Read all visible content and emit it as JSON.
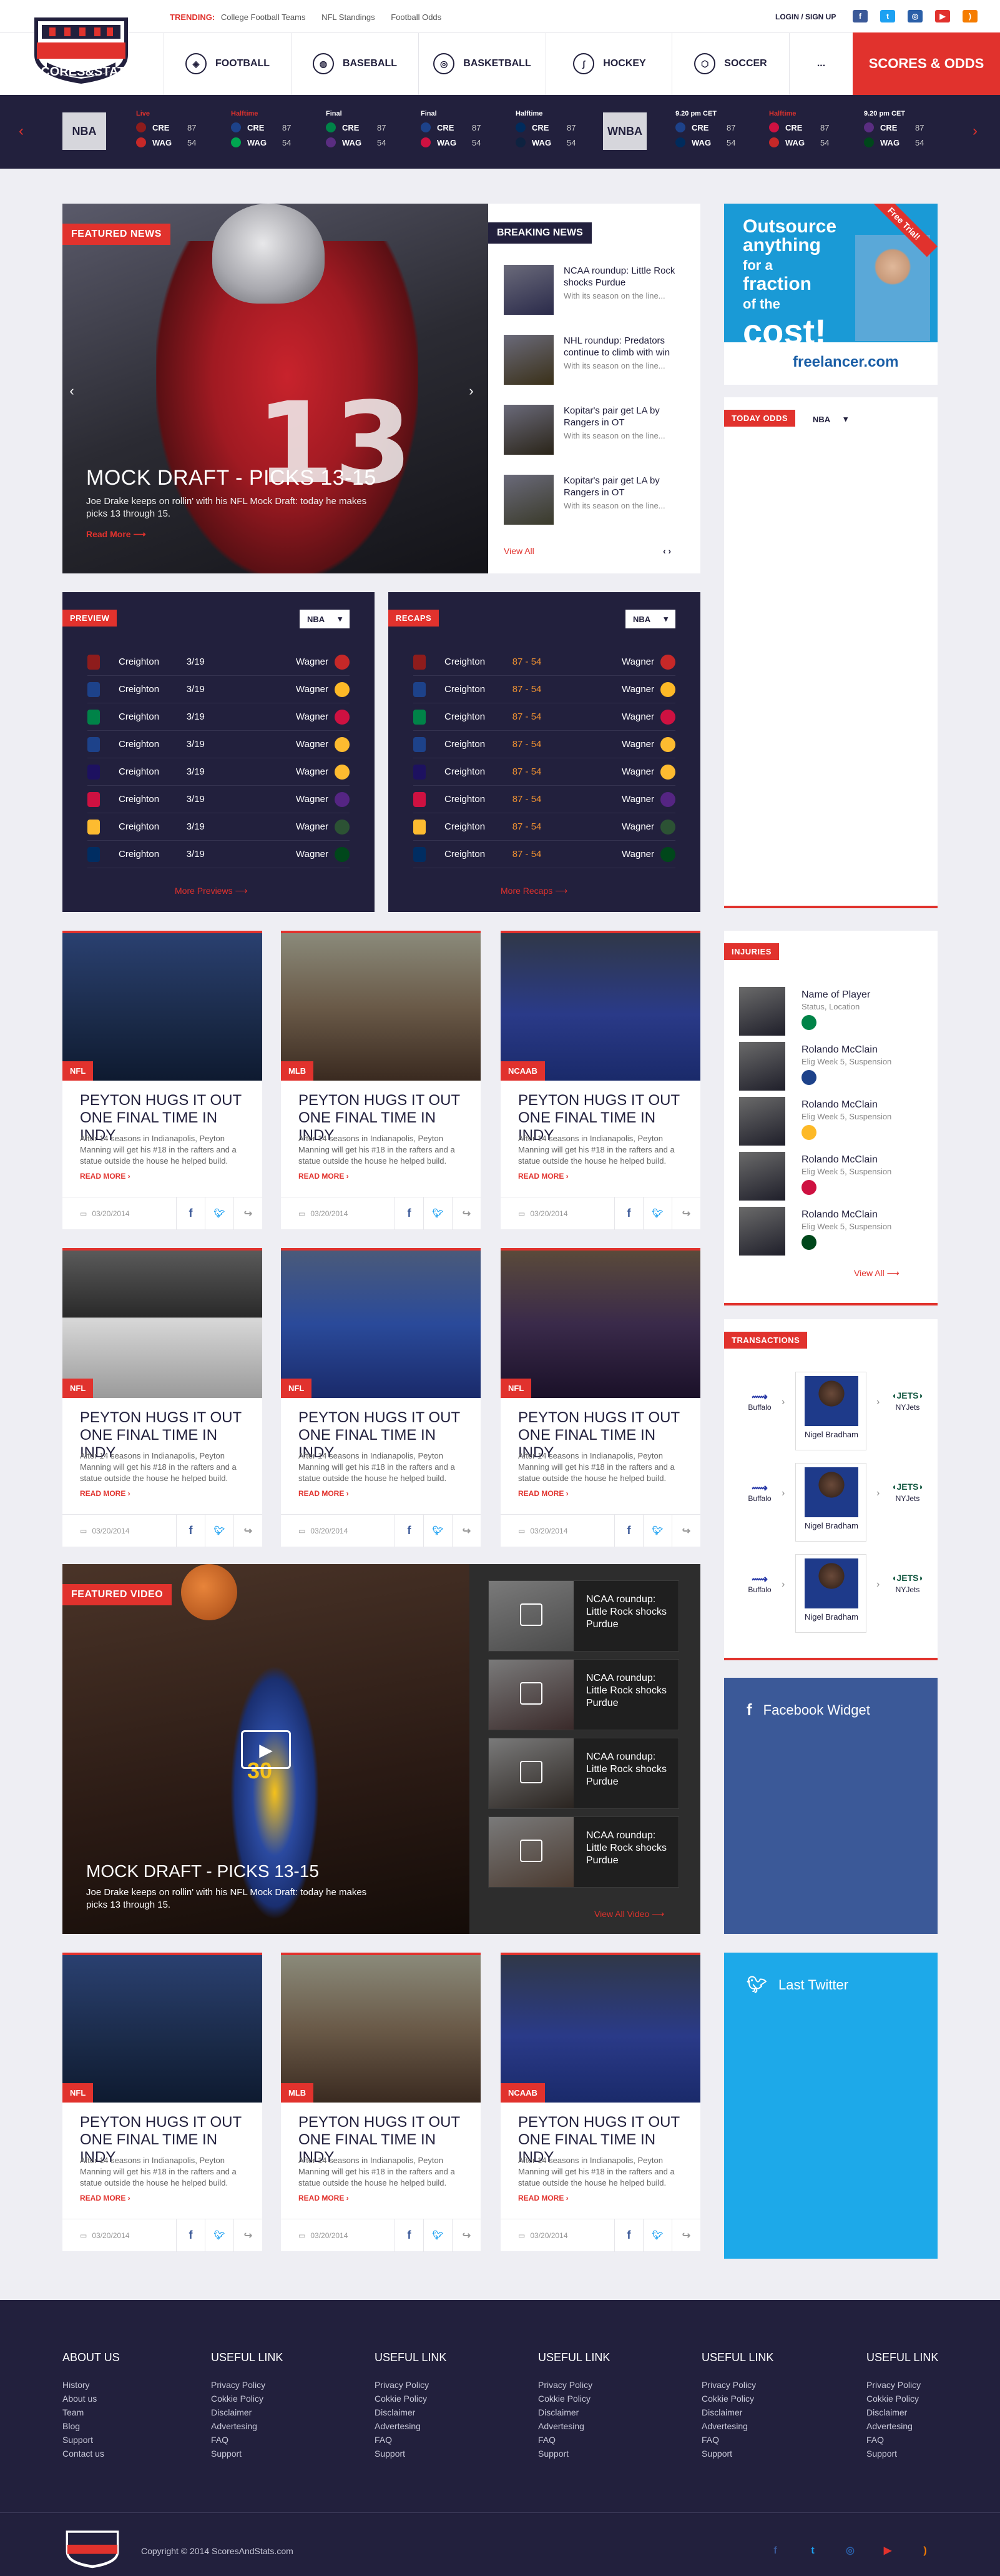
{
  "topbar": {
    "trending_label": "TRENDING:",
    "trending": [
      "College Football Teams",
      "NFL Standings",
      "Football Odds"
    ],
    "login": "LOGIN / SIGN UP",
    "social": [
      {
        "icon": "facebook-icon",
        "glyph": "f",
        "color": "#3b5998"
      },
      {
        "icon": "twitter-icon",
        "glyph": "t",
        "color": "#1da1f2"
      },
      {
        "icon": "instagram-icon",
        "glyph": "◎",
        "color": "#2a5fa8"
      },
      {
        "icon": "youtube-icon",
        "glyph": "▶",
        "color": "#e1322d"
      },
      {
        "icon": "rss-icon",
        "glyph": ")",
        "color": "#f57c00"
      }
    ]
  },
  "logo": {
    "text": "SCORES&STATS"
  },
  "nav": {
    "items": [
      {
        "label": "FOOTBALL",
        "icon": "football-icon",
        "glyph": "◈"
      },
      {
        "label": "BASEBALL",
        "icon": "baseball-icon",
        "glyph": "◍"
      },
      {
        "label": "BASKETBALL",
        "icon": "basketball-icon",
        "glyph": "◎"
      },
      {
        "label": "HOCKEY",
        "icon": "hockey-icon",
        "glyph": "∫"
      },
      {
        "label": "SOCCER",
        "icon": "soccer-icon",
        "glyph": "⬡"
      }
    ],
    "more": "...",
    "cta": "SCORES & ODDS"
  },
  "ticker": {
    "league1": "NBA",
    "league2": "WNBA",
    "games": [
      {
        "status": "Live",
        "red": true,
        "t1": "CRE",
        "s1": "87",
        "t2": "WAG",
        "s2": "54",
        "c1": "#8e1c1c",
        "c2": "#c62828"
      },
      {
        "status": "Halftime",
        "red": true,
        "t1": "CRE",
        "s1": "87",
        "t2": "WAG",
        "s2": "54",
        "c1": "#1d428a",
        "c2": "#00a650"
      },
      {
        "status": "Final",
        "red": false,
        "t1": "CRE",
        "s1": "87",
        "t2": "WAG",
        "s2": "54",
        "c1": "#008348",
        "c2": "#5a2d81"
      },
      {
        "status": "Final",
        "red": false,
        "t1": "CRE",
        "s1": "87",
        "t2": "WAG",
        "s2": "54",
        "c1": "#1d428a",
        "c2": "#ce1141"
      },
      {
        "status": "Halftime",
        "red": false,
        "t1": "CRE",
        "s1": "87",
        "t2": "WAG",
        "s2": "54",
        "c1": "#002b5c",
        "c2": "#0e2240"
      },
      {
        "status": "9.20 pm CET",
        "red": false,
        "t1": "CRE",
        "s1": "87",
        "t2": "WAG",
        "s2": "54",
        "c1": "#1d428a",
        "c2": "#002b5c"
      },
      {
        "status": "Halftime",
        "red": true,
        "t1": "CRE",
        "s1": "87",
        "t2": "WAG",
        "s2": "54",
        "c1": "#ce1141",
        "c2": "#c62828"
      },
      {
        "status": "9.20 pm CET",
        "red": false,
        "t1": "CRE",
        "s1": "87",
        "t2": "WAG",
        "s2": "54",
        "c1": "#5a2d81",
        "c2": "#00471b"
      }
    ]
  },
  "featured_news": {
    "tag": "FEATURED NEWS",
    "title": "MOCK DRAFT - PICKS 13-15",
    "text": "Joe Drake keeps on rollin' with his NFL Mock Draft: today he makes picks 13 through 15.",
    "read_more": "Read More",
    "jersey_number": "13"
  },
  "breaking": {
    "tag": "BREAKING NEWS",
    "items": [
      {
        "title": "NCAA roundup: Little Rock shocks Purdue",
        "sub": "With its season on the line..."
      },
      {
        "title": "NHL roundup: Predators continue to climb with win",
        "sub": "With its season on the line..."
      },
      {
        "title": "Kopitar's pair get LA by Rangers in OT",
        "sub": "With its season on the line..."
      },
      {
        "title": "Kopitar's pair get LA by Rangers in OT",
        "sub": "With its season on the line..."
      }
    ],
    "view_all": "View All"
  },
  "ad": {
    "line1": "Outsource",
    "line2": "anything",
    "line3": "for a",
    "line4": "fraction",
    "line5": "of the",
    "line6": "cost!",
    "ribbon": "Free Trial!",
    "brand": "freelancer.com"
  },
  "today_odds": {
    "tag": "TODAY ODDS",
    "select": "NBA"
  },
  "preview": {
    "tag": "PREVIEW",
    "select": "NBA",
    "rows": [
      {
        "t1": "Creighton",
        "mid": "3/19",
        "t2": "Wagner",
        "c1": "#8e1c1c",
        "c2": "#c62828"
      },
      {
        "t1": "Creighton",
        "mid": "3/19",
        "t2": "Wagner",
        "c1": "#1d428a",
        "c2": "#fdb927"
      },
      {
        "t1": "Creighton",
        "mid": "3/19",
        "t2": "Wagner",
        "c1": "#008348",
        "c2": "#ce1141"
      },
      {
        "t1": "Creighton",
        "mid": "3/19",
        "t2": "Wagner",
        "c1": "#1d428a",
        "c2": "#fdbb30"
      },
      {
        "t1": "Creighton",
        "mid": "3/19",
        "t2": "Wagner",
        "c1": "#1d1160",
        "c2": "#fdbb30"
      },
      {
        "t1": "Creighton",
        "mid": "3/19",
        "t2": "Wagner",
        "c1": "#ce1141",
        "c2": "#552583"
      },
      {
        "t1": "Creighton",
        "mid": "3/19",
        "t2": "Wagner",
        "c1": "#fdbb30",
        "c2": "#2c5234"
      },
      {
        "t1": "Creighton",
        "mid": "3/19",
        "t2": "Wagner",
        "c1": "#002d62",
        "c2": "#00471b"
      }
    ],
    "more": "More Previews"
  },
  "recaps": {
    "tag": "RECAPS",
    "select": "NBA",
    "rows": [
      {
        "t1": "Creighton",
        "mid": "87 - 54",
        "t2": "Wagner",
        "c1": "#8e1c1c",
        "c2": "#c62828"
      },
      {
        "t1": "Creighton",
        "mid": "87 - 54",
        "t2": "Wagner",
        "c1": "#1d428a",
        "c2": "#fdb927"
      },
      {
        "t1": "Creighton",
        "mid": "87 - 54",
        "t2": "Wagner",
        "c1": "#008348",
        "c2": "#ce1141"
      },
      {
        "t1": "Creighton",
        "mid": "87 - 54",
        "t2": "Wagner",
        "c1": "#1d428a",
        "c2": "#fdbb30"
      },
      {
        "t1": "Creighton",
        "mid": "87 - 54",
        "t2": "Wagner",
        "c1": "#1d1160",
        "c2": "#fdbb30"
      },
      {
        "t1": "Creighton",
        "mid": "87 - 54",
        "t2": "Wagner",
        "c1": "#ce1141",
        "c2": "#552583"
      },
      {
        "t1": "Creighton",
        "mid": "87 - 54",
        "t2": "Wagner",
        "c1": "#fdbb30",
        "c2": "#2c5234"
      },
      {
        "t1": "Creighton",
        "mid": "87 - 54",
        "t2": "Wagner",
        "c1": "#002d62",
        "c2": "#00471b"
      }
    ],
    "more": "More Recaps"
  },
  "cards": [
    {
      "label": "NFL",
      "title": "PEYTON HUGS IT OUT ONE FINAL TIME IN INDY",
      "text": "After 14 seasons in Indianapolis, Peyton Manning will get his #18 in the rafters and a statue outside the house he helped build.",
      "read_more": "READ MORE",
      "date": "03/20/2014",
      "bg": "linear-gradient(180deg,#2a4070 0%,#1a2a48 60%,#0e1a30 100%)"
    },
    {
      "label": "MLB",
      "title": "PEYTON HUGS IT OUT ONE FINAL TIME IN INDY",
      "text": "After 14 seasons in Indianapolis, Peyton Manning will get his #18 in the rafters and a statue outside the house he helped build.",
      "read_more": "READ MORE",
      "date": "03/20/2014",
      "bg": "linear-gradient(180deg,#8a8a7a 0%,#6a5a48 50%,#3a2a20 100%)"
    },
    {
      "label": "NCAAB",
      "title": "PEYTON HUGS IT OUT ONE FINAL TIME IN INDY",
      "text": "After 14 seasons in Indianapolis, Peyton Manning will get his #18 in the rafters and a statue outside the house he helped build.",
      "read_more": "READ MORE",
      "date": "03/20/2014",
      "bg": "linear-gradient(180deg,#303848 0%,#2a3a88 55%,#1a2a6a 100%)"
    },
    {
      "label": "NFL",
      "title": "PEYTON HUGS IT OUT ONE FINAL TIME IN INDY",
      "text": "After 14 seasons in Indianapolis, Peyton Manning will get his #18 in the rafters and a statue outside the house he helped build.",
      "read_more": "READ MORE",
      "date": "03/20/2014",
      "bg": "linear-gradient(180deg,#5a5a5a 0%,#2a2a2a 45%,#d8d8d8 46%,#9a9a9a 100%)"
    },
    {
      "label": "NFL",
      "title": "PEYTON HUGS IT OUT ONE FINAL TIME IN INDY",
      "text": "After 14 seasons in Indianapolis, Peyton Manning will get his #18 in the rafters and a statue outside the house he helped build.",
      "read_more": "READ MORE",
      "date": "03/20/2014",
      "bg": "linear-gradient(180deg,#4a5a7a 0%,#2a4a9a 50%,#1a2a6a 100%)"
    },
    {
      "label": "NFL",
      "title": "PEYTON HUGS IT OUT ONE FINAL TIME IN INDY",
      "text": "After 14 seasons in Indianapolis, Peyton Manning will get his #18 in the rafters and a statue outside the house he helped build.",
      "read_more": "READ MORE",
      "date": "03/20/2014",
      "bg": "linear-gradient(180deg,#5a4a3a 0%,#3a2a4a 50%,#1a1028 100%)"
    },
    {
      "label": "NFL",
      "title": "PEYTON HUGS IT OUT ONE FINAL TIME IN INDY",
      "text": "After 14 seasons in Indianapolis, Peyton Manning will get his #18 in the rafters and a statue outside the house he helped build.",
      "read_more": "READ MORE",
      "date": "03/20/2014",
      "bg": "linear-gradient(180deg,#2a4070 0%,#1a2a48 60%,#0e1a30 100%)"
    },
    {
      "label": "MLB",
      "title": "PEYTON HUGS IT OUT ONE FINAL TIME IN INDY",
      "text": "After 14 seasons in Indianapolis, Peyton Manning will get his #18 in the rafters and a statue outside the house he helped build.",
      "read_more": "READ MORE",
      "date": "03/20/2014",
      "bg": "linear-gradient(180deg,#8a8a7a 0%,#6a5a48 50%,#3a2a20 100%)"
    },
    {
      "label": "NCAAB",
      "title": "PEYTON HUGS IT OUT ONE FINAL TIME IN INDY",
      "text": "After 14 seasons in Indianapolis, Peyton Manning will get his #18 in the rafters and a statue outside the house he helped build.",
      "read_more": "READ MORE",
      "date": "03/20/2014",
      "bg": "linear-gradient(180deg,#303848 0%,#2a3a88 55%,#1a2a6a 100%)"
    }
  ],
  "injuries": {
    "tag": "INJURIES",
    "items": [
      {
        "name": "Name of Player",
        "status": "Status, Location",
        "color": "#008348"
      },
      {
        "name": "Rolando McClain",
        "status": "Elig Week 5, Suspension",
        "color": "#1d428a"
      },
      {
        "name": "Rolando McClain",
        "status": "Elig Week 5, Suspension",
        "color": "#fdb927"
      },
      {
        "name": "Rolando McClain",
        "status": "Elig Week 5, Suspension",
        "color": "#ce1141"
      },
      {
        "name": "Rolando McClain",
        "status": "Elig Week 5, Suspension",
        "color": "#00471b"
      }
    ],
    "view_all": "View All"
  },
  "transactions": {
    "tag": "TRANSACTIONS",
    "items": [
      {
        "from": "Buffalo",
        "player": "Nigel Bradham",
        "to": "NYJets"
      },
      {
        "from": "Buffalo",
        "player": "Nigel Bradham",
        "to": "NYJets"
      },
      {
        "from": "Buffalo",
        "player": "Nigel Bradham",
        "to": "NYJets"
      }
    ]
  },
  "featured_video": {
    "tag": "FEATURED VIDEO",
    "title": "MOCK DRAFT - PICKS 13-15",
    "text": "Joe Drake keeps on rollin' with his NFL Mock Draft: today he makes picks 13 through 15.",
    "jersey_number": "30",
    "items": [
      {
        "title": "NCAA roundup: Little Rock shocks Purdue"
      },
      {
        "title": "NCAA roundup: Little Rock shocks Purdue"
      },
      {
        "title": "NCAA roundup: Little Rock shocks Purdue"
      },
      {
        "title": "NCAA roundup: Little Rock shocks Purdue"
      }
    ],
    "view_all": "View All Video"
  },
  "facebook": {
    "title": "Facebook Widget"
  },
  "twitter": {
    "title": "Last Twitter"
  },
  "footer": {
    "columns": [
      {
        "title": "ABOUT US",
        "links": [
          "History",
          "About us",
          "Team",
          "Blog",
          "Support",
          "Contact us"
        ]
      },
      {
        "title": "USEFUL LINK",
        "links": [
          "Privacy Policy",
          "Cokkie Policy",
          "Disclaimer",
          "Advertesing",
          "FAQ",
          "Support"
        ]
      },
      {
        "title": "USEFUL LINK",
        "links": [
          "Privacy Policy",
          "Cokkie Policy",
          "Disclaimer",
          "Advertesing",
          "FAQ",
          "Support"
        ]
      },
      {
        "title": "USEFUL LINK",
        "links": [
          "Privacy Policy",
          "Cokkie Policy",
          "Disclaimer",
          "Advertesing",
          "FAQ",
          "Support"
        ]
      },
      {
        "title": "USEFUL LINK",
        "links": [
          "Privacy Policy",
          "Cokkie Policy",
          "Disclaimer",
          "Advertesing",
          "FAQ",
          "Support"
        ]
      },
      {
        "title": "USEFUL LINK",
        "links": [
          "Privacy Policy",
          "Cokkie Policy",
          "Disclaimer",
          "Advertesing",
          "FAQ",
          "Support"
        ]
      }
    ],
    "copyright": "Copyright © 2014 ScoresAndStats.com",
    "social": [
      {
        "icon": "facebook-icon",
        "glyph": "f",
        "color": "#3b5998"
      },
      {
        "icon": "twitter-icon",
        "glyph": "t",
        "color": "#1da1f2"
      },
      {
        "icon": "instagram-icon",
        "glyph": "◎",
        "color": "#2a5fa8"
      },
      {
        "icon": "youtube-icon",
        "glyph": "▶",
        "color": "#e1322d"
      },
      {
        "icon": "rss-icon",
        "glyph": ")",
        "color": "#f57c00"
      }
    ]
  }
}
